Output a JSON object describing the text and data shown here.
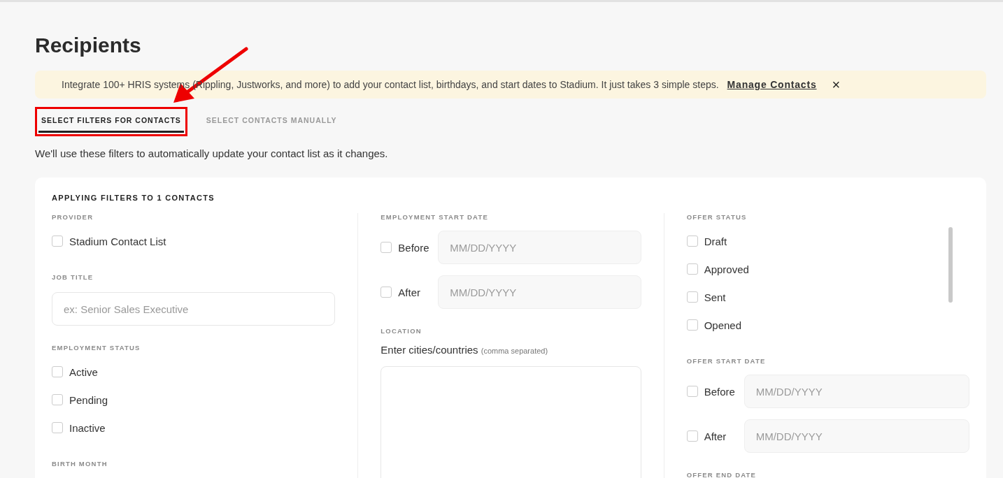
{
  "page": {
    "title": "Recipients"
  },
  "banner": {
    "text": "Integrate 100+ HRIS systems (Rippling, Justworks, and more) to add your contact list, birthdays, and start dates to Stadium. It just takes 3 simple steps.",
    "link": "Manage Contacts",
    "close": "×"
  },
  "tabs": [
    {
      "label": "SELECT FILTERS FOR CONTACTS",
      "selected": true,
      "highlighted": true
    },
    {
      "label": "SELECT CONTACTS MANUALLY",
      "selected": false,
      "highlighted": false
    }
  ],
  "description": "We'll use these filters to automatically update your contact list as it changes.",
  "filters": {
    "heading": "APPLYING FILTERS TO 1 CONTACTS",
    "columns": [
      {
        "sections": [
          {
            "kind": "checkboxes",
            "label": "PROVIDER",
            "options": [
              {
                "label": "Stadium Contact List",
                "checked": false
              }
            ]
          },
          {
            "kind": "text",
            "label": "JOB TITLE",
            "placeholder": "ex: Senior Sales Executive"
          },
          {
            "kind": "checkboxes",
            "label": "EMPLOYMENT STATUS",
            "options": [
              {
                "label": "Active",
                "checked": false
              },
              {
                "label": "Pending",
                "checked": false
              },
              {
                "label": "Inactive",
                "checked": false
              }
            ]
          },
          {
            "kind": "heading",
            "label": "BIRTH MONTH"
          }
        ]
      },
      {
        "sections": [
          {
            "kind": "dates",
            "label": "EMPLOYMENT START DATE",
            "rows": [
              {
                "label": "Before",
                "checked": false,
                "placeholder": "MM/DD/YYYY"
              },
              {
                "label": "After",
                "checked": false,
                "placeholder": "MM/DD/YYYY"
              }
            ]
          },
          {
            "kind": "location",
            "label": "LOCATION",
            "prompt": "Enter cities/countries",
            "hint": "(comma separated)"
          }
        ]
      },
      {
        "sections": [
          {
            "kind": "checkboxes",
            "label": "OFFER STATUS",
            "options": [
              {
                "label": "Draft",
                "checked": false
              },
              {
                "label": "Approved",
                "checked": false
              },
              {
                "label": "Sent",
                "checked": false
              },
              {
                "label": "Opened",
                "checked": false
              }
            ]
          },
          {
            "kind": "dates",
            "label": "OFFER START DATE",
            "rows": [
              {
                "label": "Before",
                "checked": false,
                "placeholder": "MM/DD/YYYY"
              },
              {
                "label": "After",
                "checked": false,
                "placeholder": "MM/DD/YYYY"
              }
            ]
          },
          {
            "kind": "heading",
            "label": "OFFER END DATE"
          }
        ]
      }
    ]
  }
}
